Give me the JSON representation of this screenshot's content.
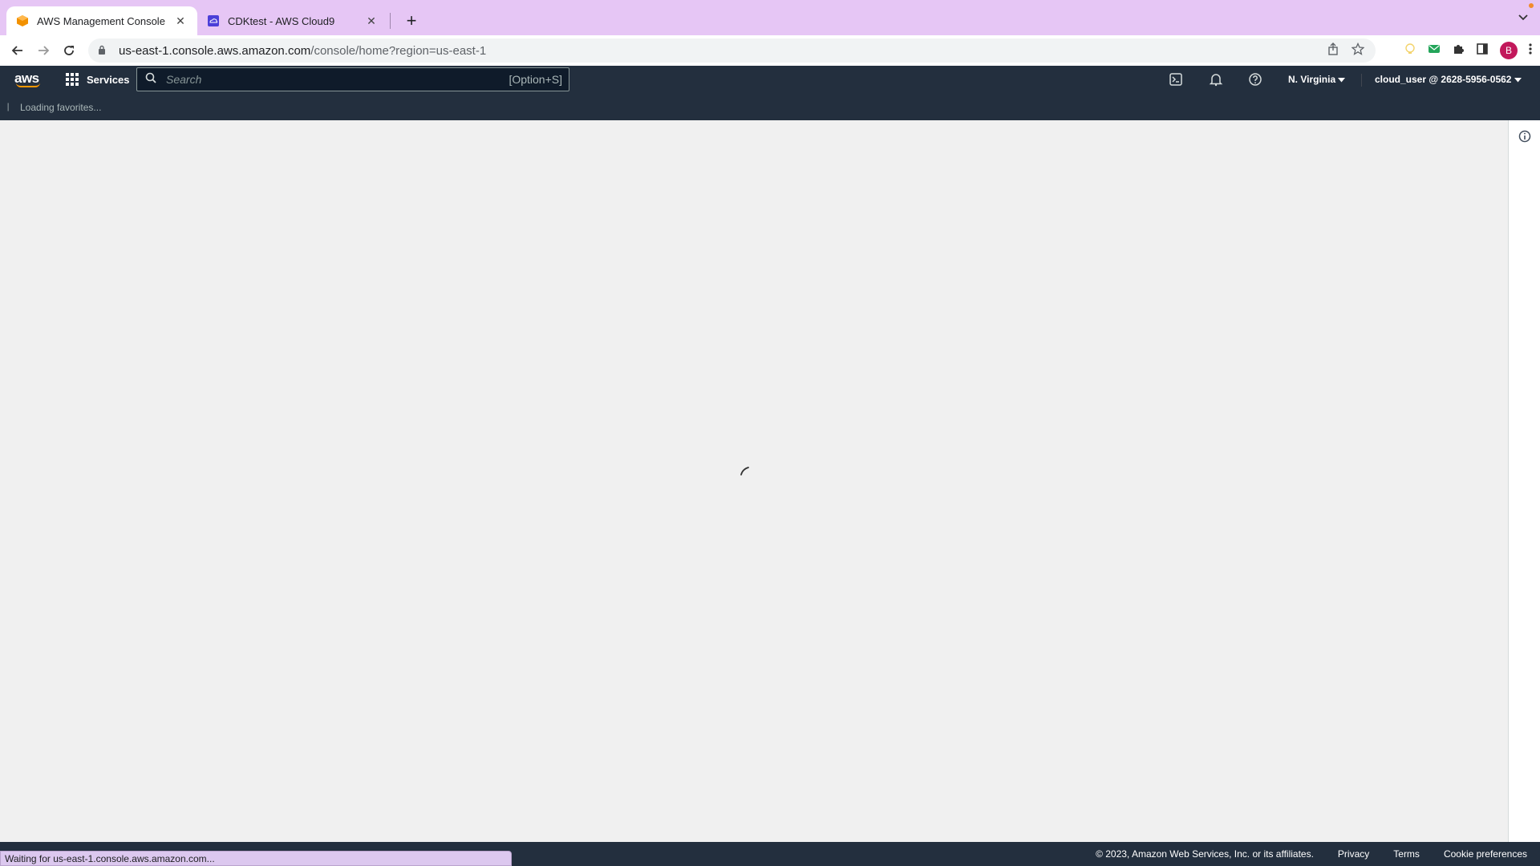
{
  "browser": {
    "tabs": [
      {
        "title": "AWS Management Console",
        "active": true,
        "favicon": "aws-cube-icon"
      },
      {
        "title": "CDKtest - AWS Cloud9",
        "active": false,
        "favicon": "cloud9-icon"
      }
    ],
    "new_tab": "+",
    "url_host": "us-east-1.console.aws.amazon.com",
    "url_path": "/console/home?region=us-east-1",
    "avatar_letter": "B",
    "status_text": "Waiting for us-east-1.console.aws.amazon.com..."
  },
  "aws": {
    "logo": "aws",
    "services_label": "Services",
    "search_placeholder": "Search",
    "search_shortcut": "[Option+S]",
    "region": "N. Virginia",
    "account": "cloud_user @ 2628-5956-0562",
    "favorites_loading": "Loading favorites..."
  },
  "footer": {
    "copyright": "© 2023, Amazon Web Services, Inc. or its affiliates.",
    "links": [
      "Privacy",
      "Terms",
      "Cookie preferences"
    ]
  },
  "colors": {
    "aws_navy": "#232f3e",
    "aws_orange": "#ff9900",
    "tabbar": "#e6c6f5"
  }
}
